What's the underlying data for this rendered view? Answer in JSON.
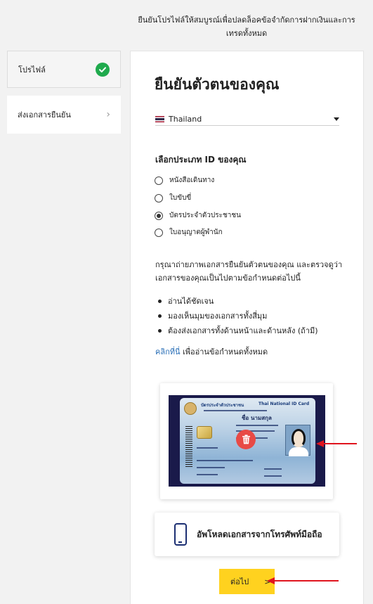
{
  "notice": "ยืนยันโปรไฟล์ให้สมบูรณ์เพื่อปลดล็อคข้อจำกัดการฝากเงินและการเทรดทั้งหมด",
  "sidebar": {
    "steps": [
      {
        "label": "โปรไฟล์",
        "icon": "check-circle-icon",
        "status": "completed"
      },
      {
        "label": "ส่งเอกสารยืนยัน",
        "icon": "chevron-right-icon"
      }
    ]
  },
  "main": {
    "title": "ยืนยันตัวตนของคุณ",
    "country": {
      "value": "Thailand",
      "flag": "thailand-flag-icon"
    },
    "id_heading": "เลือกประเภท ID ของคุณ",
    "id_types": [
      {
        "label": "หนังสือเดินทาง",
        "selected": false
      },
      {
        "label": "ใบขับขี่",
        "selected": false
      },
      {
        "label": "บัตรประจำตัวประชาชน",
        "selected": true
      },
      {
        "label": "ใบอนุญาตผู้พำนัก",
        "selected": false
      }
    ],
    "instructions": "กรุณาถ่ายภาพเอกสารยืนยันตัวตนของคุณ และตรวจดูว่าเอกสารของคุณเป็นไปตามข้อกำหนดต่อไปนี้",
    "requirements": [
      "อ่านได้ชัดเจน",
      "มองเห็นมุมของเอกสารทั้งสี่มุม",
      "ต้องส่งเอกสารทั้งด้านหน้าและด้านหลัง (ถ้ามี)"
    ],
    "terms_link": "คลิกที่นี่",
    "terms_text": "เพื่ออ่านข้อกำหนดทั้งหมด",
    "id_card": {
      "header_th": "บัตรประจำตัวประชาชน",
      "header_en": "Thai National ID Card",
      "name": "ชื่อ นามสกุล"
    },
    "mobile_upload": "อัพโหลดเอกสารจากโทรศัพท์มือถือ",
    "next_label": "ต่อไป",
    "next_arrow": ">"
  },
  "colors": {
    "accent": "#ffd21f",
    "success": "#1faa4d",
    "link": "#2a6fb7",
    "delete": "#e84a46",
    "annotation": "#e0141e"
  }
}
